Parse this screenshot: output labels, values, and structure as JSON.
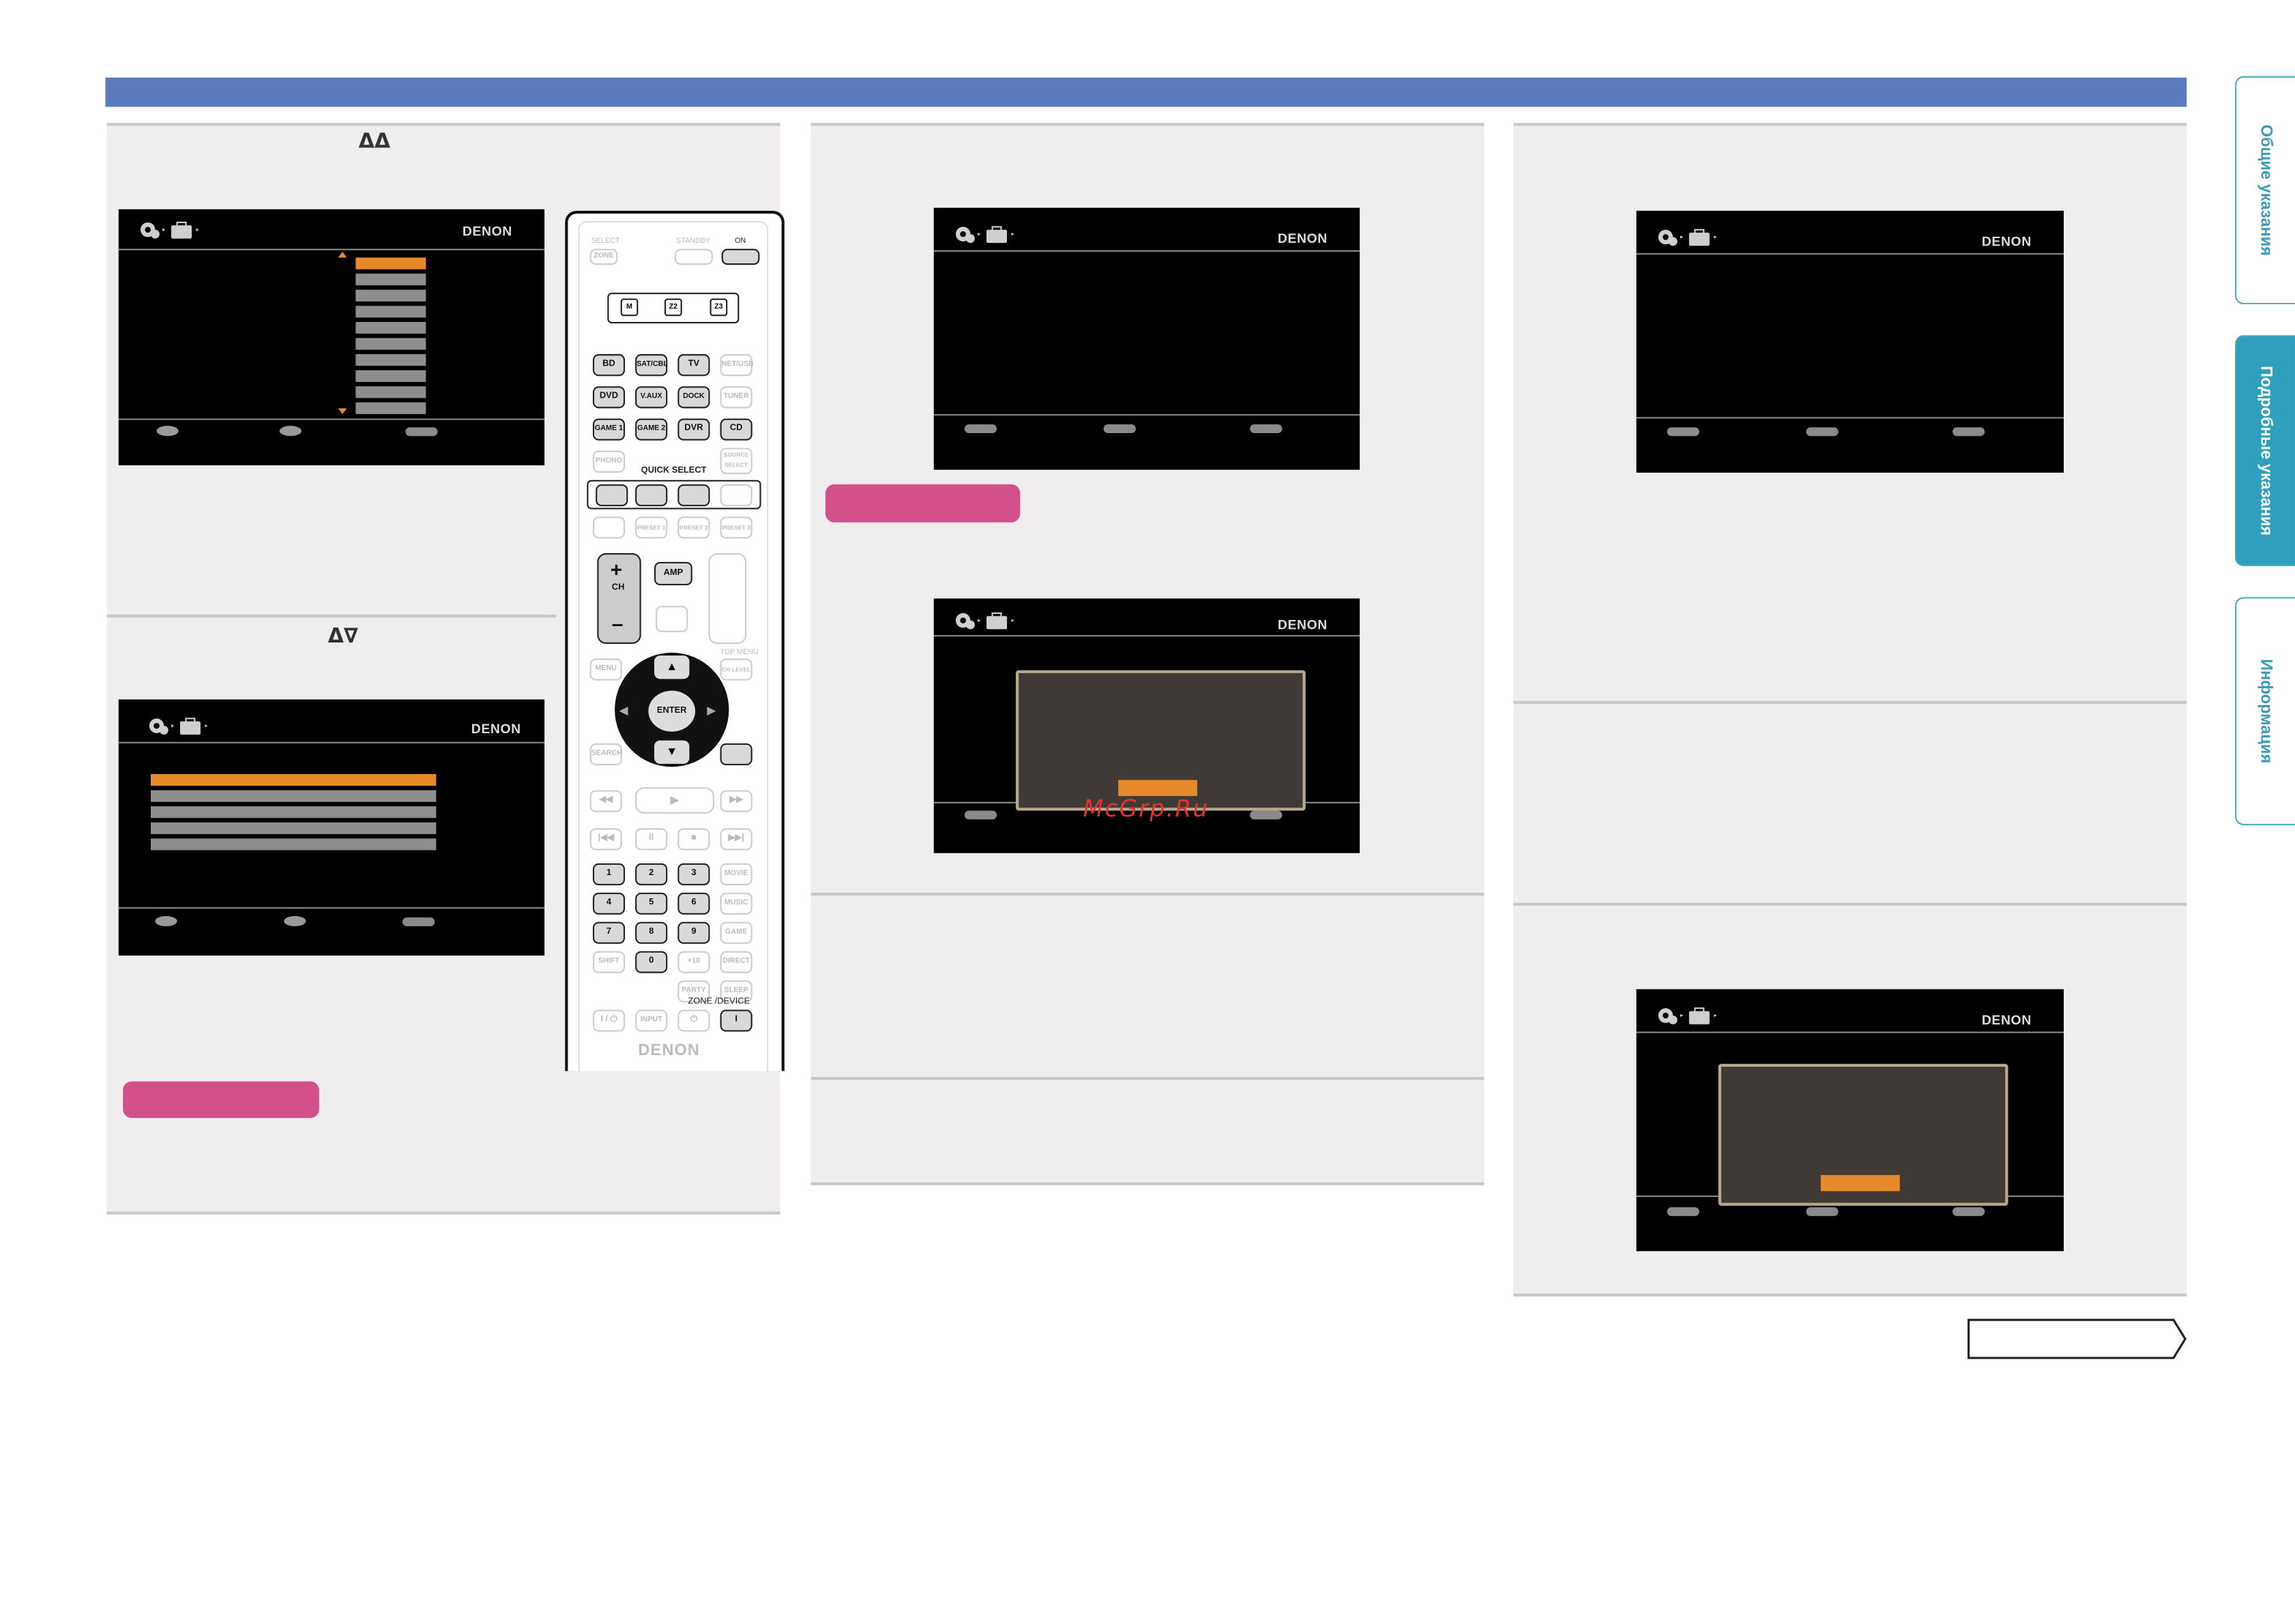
{
  "header_bar_color": "#5b7bbf",
  "brand": "DENON",
  "step_arrows": "ΔΔ",
  "step_arrows_2": "Δ∇",
  "tabs": [
    {
      "label": "Общие указания"
    },
    {
      "label": "Подробные указания"
    },
    {
      "label": "Информация"
    }
  ],
  "watermark": "McGrp.Ru",
  "remote": {
    "brand": "DENON",
    "quick_select": "QUICK SELECT",
    "zone_device": "ZONE /DEVICE",
    "top_labels": {
      "select": "SELECT",
      "standby": "STANDBY",
      "on": "ON",
      "zone": "ZONE"
    },
    "zone_buttons": [
      "M",
      "Z2",
      "Z3"
    ],
    "source_rows": [
      [
        "BD",
        "SAT/CBL",
        "TV",
        "NET/USB"
      ],
      [
        "DVD",
        "V.AUX",
        "DOCK",
        "TUNER"
      ],
      [
        "GAME 1",
        "GAME 2",
        "DVR",
        "CD"
      ],
      [
        "PHONO",
        "",
        "",
        "SOURCE SELECT"
      ]
    ],
    "amp": "AMP",
    "ch": "CH",
    "enter": "ENTER",
    "menu": "MENU",
    "search": "SEARCH",
    "ch_level": "CH LEVEL",
    "number_rows": [
      [
        "1",
        "2",
        "3",
        "MOVIE"
      ],
      [
        "4",
        "5",
        "6",
        "MUSIC"
      ],
      [
        "7",
        "8",
        "9",
        "GAME"
      ],
      [
        "SHIFT",
        "0",
        "+10",
        "DIRECT"
      ]
    ],
    "party": "PARTY",
    "sleep": "SLEEP",
    "input": "INPUT",
    "presets": [
      "PRESET 1",
      "PRESET 2",
      "PRESET 3"
    ]
  }
}
